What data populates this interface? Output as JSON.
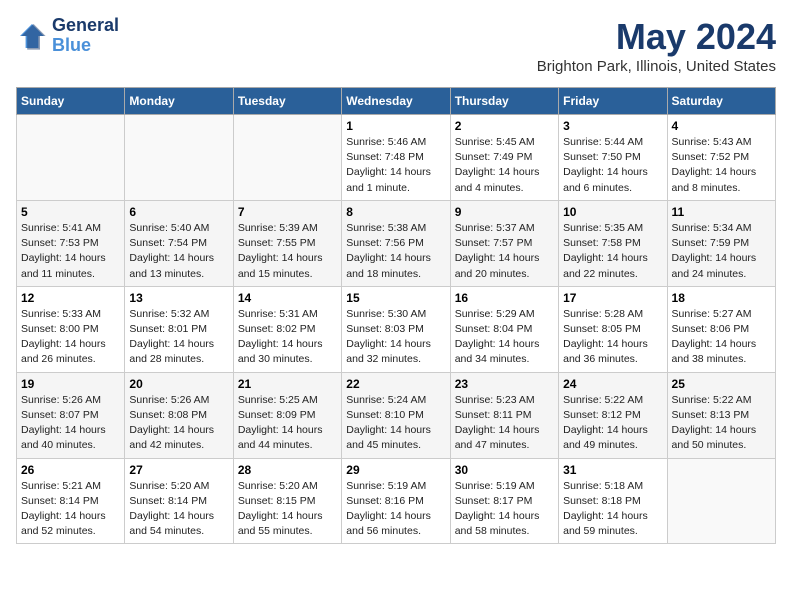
{
  "logo": {
    "line1": "General",
    "line2": "Blue"
  },
  "title": "May 2024",
  "subtitle": "Brighton Park, Illinois, United States",
  "days_of_week": [
    "Sunday",
    "Monday",
    "Tuesday",
    "Wednesday",
    "Thursday",
    "Friday",
    "Saturday"
  ],
  "weeks": [
    [
      {
        "day": "",
        "info": ""
      },
      {
        "day": "",
        "info": ""
      },
      {
        "day": "",
        "info": ""
      },
      {
        "day": "1",
        "info": "Sunrise: 5:46 AM\nSunset: 7:48 PM\nDaylight: 14 hours\nand 1 minute."
      },
      {
        "day": "2",
        "info": "Sunrise: 5:45 AM\nSunset: 7:49 PM\nDaylight: 14 hours\nand 4 minutes."
      },
      {
        "day": "3",
        "info": "Sunrise: 5:44 AM\nSunset: 7:50 PM\nDaylight: 14 hours\nand 6 minutes."
      },
      {
        "day": "4",
        "info": "Sunrise: 5:43 AM\nSunset: 7:52 PM\nDaylight: 14 hours\nand 8 minutes."
      }
    ],
    [
      {
        "day": "5",
        "info": "Sunrise: 5:41 AM\nSunset: 7:53 PM\nDaylight: 14 hours\nand 11 minutes."
      },
      {
        "day": "6",
        "info": "Sunrise: 5:40 AM\nSunset: 7:54 PM\nDaylight: 14 hours\nand 13 minutes."
      },
      {
        "day": "7",
        "info": "Sunrise: 5:39 AM\nSunset: 7:55 PM\nDaylight: 14 hours\nand 15 minutes."
      },
      {
        "day": "8",
        "info": "Sunrise: 5:38 AM\nSunset: 7:56 PM\nDaylight: 14 hours\nand 18 minutes."
      },
      {
        "day": "9",
        "info": "Sunrise: 5:37 AM\nSunset: 7:57 PM\nDaylight: 14 hours\nand 20 minutes."
      },
      {
        "day": "10",
        "info": "Sunrise: 5:35 AM\nSunset: 7:58 PM\nDaylight: 14 hours\nand 22 minutes."
      },
      {
        "day": "11",
        "info": "Sunrise: 5:34 AM\nSunset: 7:59 PM\nDaylight: 14 hours\nand 24 minutes."
      }
    ],
    [
      {
        "day": "12",
        "info": "Sunrise: 5:33 AM\nSunset: 8:00 PM\nDaylight: 14 hours\nand 26 minutes."
      },
      {
        "day": "13",
        "info": "Sunrise: 5:32 AM\nSunset: 8:01 PM\nDaylight: 14 hours\nand 28 minutes."
      },
      {
        "day": "14",
        "info": "Sunrise: 5:31 AM\nSunset: 8:02 PM\nDaylight: 14 hours\nand 30 minutes."
      },
      {
        "day": "15",
        "info": "Sunrise: 5:30 AM\nSunset: 8:03 PM\nDaylight: 14 hours\nand 32 minutes."
      },
      {
        "day": "16",
        "info": "Sunrise: 5:29 AM\nSunset: 8:04 PM\nDaylight: 14 hours\nand 34 minutes."
      },
      {
        "day": "17",
        "info": "Sunrise: 5:28 AM\nSunset: 8:05 PM\nDaylight: 14 hours\nand 36 minutes."
      },
      {
        "day": "18",
        "info": "Sunrise: 5:27 AM\nSunset: 8:06 PM\nDaylight: 14 hours\nand 38 minutes."
      }
    ],
    [
      {
        "day": "19",
        "info": "Sunrise: 5:26 AM\nSunset: 8:07 PM\nDaylight: 14 hours\nand 40 minutes."
      },
      {
        "day": "20",
        "info": "Sunrise: 5:26 AM\nSunset: 8:08 PM\nDaylight: 14 hours\nand 42 minutes."
      },
      {
        "day": "21",
        "info": "Sunrise: 5:25 AM\nSunset: 8:09 PM\nDaylight: 14 hours\nand 44 minutes."
      },
      {
        "day": "22",
        "info": "Sunrise: 5:24 AM\nSunset: 8:10 PM\nDaylight: 14 hours\nand 45 minutes."
      },
      {
        "day": "23",
        "info": "Sunrise: 5:23 AM\nSunset: 8:11 PM\nDaylight: 14 hours\nand 47 minutes."
      },
      {
        "day": "24",
        "info": "Sunrise: 5:22 AM\nSunset: 8:12 PM\nDaylight: 14 hours\nand 49 minutes."
      },
      {
        "day": "25",
        "info": "Sunrise: 5:22 AM\nSunset: 8:13 PM\nDaylight: 14 hours\nand 50 minutes."
      }
    ],
    [
      {
        "day": "26",
        "info": "Sunrise: 5:21 AM\nSunset: 8:14 PM\nDaylight: 14 hours\nand 52 minutes."
      },
      {
        "day": "27",
        "info": "Sunrise: 5:20 AM\nSunset: 8:14 PM\nDaylight: 14 hours\nand 54 minutes."
      },
      {
        "day": "28",
        "info": "Sunrise: 5:20 AM\nSunset: 8:15 PM\nDaylight: 14 hours\nand 55 minutes."
      },
      {
        "day": "29",
        "info": "Sunrise: 5:19 AM\nSunset: 8:16 PM\nDaylight: 14 hours\nand 56 minutes."
      },
      {
        "day": "30",
        "info": "Sunrise: 5:19 AM\nSunset: 8:17 PM\nDaylight: 14 hours\nand 58 minutes."
      },
      {
        "day": "31",
        "info": "Sunrise: 5:18 AM\nSunset: 8:18 PM\nDaylight: 14 hours\nand 59 minutes."
      },
      {
        "day": "",
        "info": ""
      }
    ]
  ]
}
